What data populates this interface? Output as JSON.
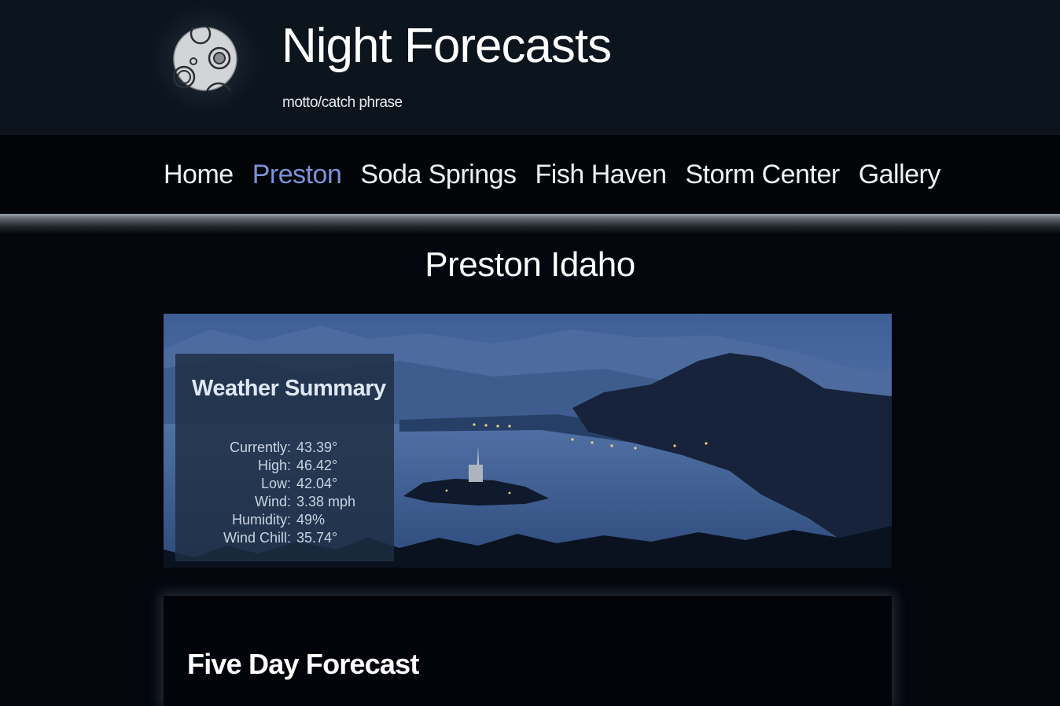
{
  "header": {
    "title": "Night Forecasts",
    "motto": "motto/catch phrase",
    "logo_icon": "moon-icon"
  },
  "nav": {
    "items": [
      {
        "label": "Home",
        "active": false
      },
      {
        "label": "Preston",
        "active": true
      },
      {
        "label": "Soda Springs",
        "active": false
      },
      {
        "label": "Fish Haven",
        "active": false
      },
      {
        "label": "Storm Center",
        "active": false
      },
      {
        "label": "Gallery",
        "active": false
      }
    ]
  },
  "main": {
    "title": "Preston Idaho",
    "summary": {
      "heading": "Weather Summary",
      "rows": [
        {
          "label": "Currently:",
          "value": "43.39°"
        },
        {
          "label": "High:",
          "value": "46.42°"
        },
        {
          "label": "Low:",
          "value": "42.04°"
        },
        {
          "label": "Wind:",
          "value": "3.38 mph"
        },
        {
          "label": "Humidity:",
          "value": "49%"
        },
        {
          "label": "Wind Chill:",
          "value": "35.74°"
        }
      ]
    },
    "forecast": {
      "heading": "Five Day Forecast"
    }
  },
  "colors": {
    "header_bg": "#0c141d",
    "nav_bg": "#010307",
    "page_bg": "#03060d",
    "nav_active": "#7b93da"
  }
}
